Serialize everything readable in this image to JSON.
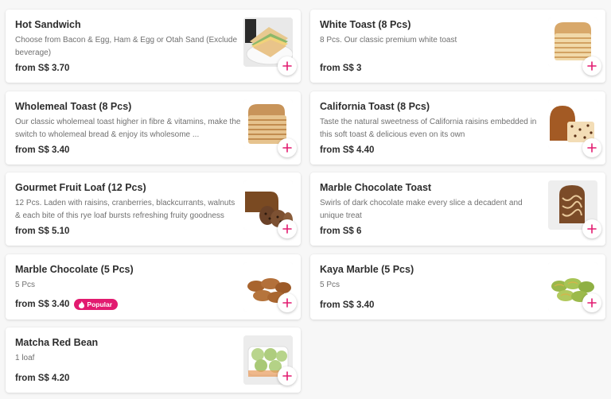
{
  "accent_color": "#e21b70",
  "items": [
    {
      "name": "Hot Sandwich",
      "description": "Choose from Bacon & Egg, Ham & Egg or Otah Sand (Exclude beverage)",
      "price": "from S$ 3.70",
      "image_icon": "sandwich-image",
      "badge": ""
    },
    {
      "name": "White Toast (8 Pcs)",
      "description": "8 Pcs. Our classic premium white toast",
      "price": "from S$ 3",
      "image_icon": "toast-stack-image",
      "badge": ""
    },
    {
      "name": "Wholemeal Toast (8 Pcs)",
      "description": "Our classic wholemeal toast higher in fibre & vitamins, make the switch to wholemeal bread & enjoy its wholesome ...",
      "price": "from S$ 3.40",
      "image_icon": "toast-stack-image",
      "badge": ""
    },
    {
      "name": "California Toast (8 Pcs)",
      "description": "Taste the natural sweetness of California raisins embedded in this soft toast & delicious even on its own",
      "price": "from S$ 4.40",
      "image_icon": "raisin-loaf-image",
      "badge": ""
    },
    {
      "name": "Gourmet Fruit Loaf (12 Pcs)",
      "description": "12 Pcs. Laden with raisins, cranberries, blackcurrants, walnuts & each bite of this rye loaf bursts refreshing fruity goodness",
      "price": "from S$ 5.10",
      "image_icon": "fruit-loaf-image",
      "badge": ""
    },
    {
      "name": "Marble Chocolate Toast",
      "description": "Swirls of dark chocolate make every slice a decadent and unique treat",
      "price": "from S$ 6",
      "image_icon": "marble-loaf-image",
      "badge": ""
    },
    {
      "name": "Marble Chocolate (5 Pcs)",
      "description": "5 Pcs",
      "price": "from S$ 3.40",
      "image_icon": "chocolate-buns-image",
      "badge": "Popular"
    },
    {
      "name": "Kaya Marble (5 Pcs)",
      "description": "5 Pcs",
      "price": "from S$ 3.40",
      "image_icon": "kaya-buns-image",
      "badge": ""
    },
    {
      "name": "Matcha Red Bean",
      "description": "1 loaf",
      "price": "from S$ 4.20",
      "image_icon": "matcha-buns-image",
      "badge": ""
    }
  ]
}
